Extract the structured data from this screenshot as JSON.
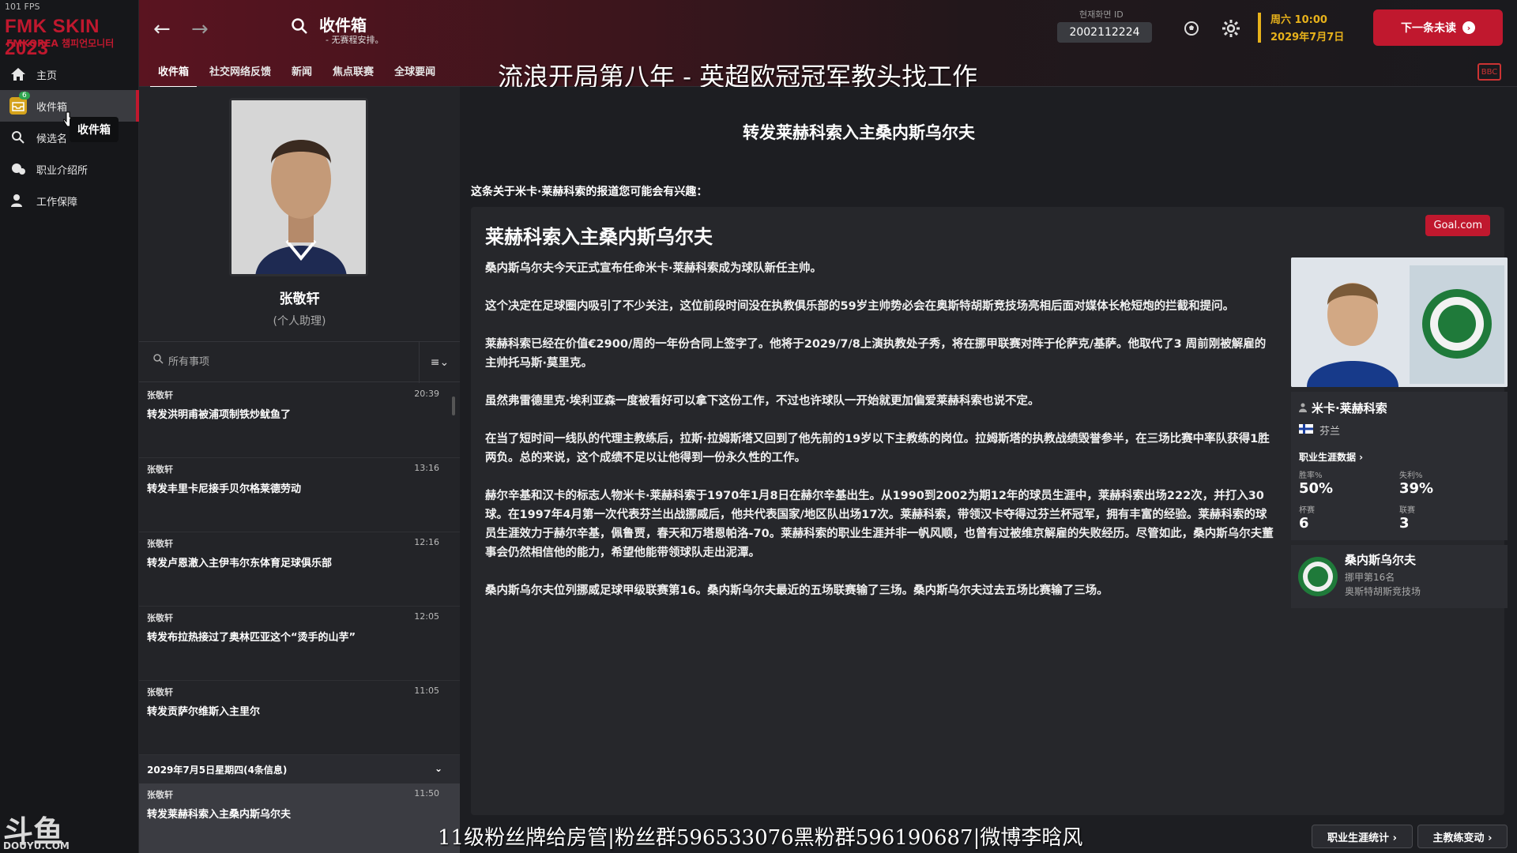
{
  "app": {
    "fps": "101 FPS",
    "logo": "FMK SKIN 2023",
    "logo_sub": "FMKOREA 챔피언모니터"
  },
  "sidebar": {
    "items": [
      {
        "label": "主页",
        "icon": "home-icon"
      },
      {
        "label": "收件箱",
        "icon": "inbox-icon",
        "badge": "6"
      },
      {
        "label": "候选名",
        "icon": "search-icon"
      },
      {
        "label": "职业介绍所",
        "icon": "agency-icon"
      },
      {
        "label": "工作保障",
        "icon": "job-security-icon"
      }
    ],
    "tooltip": "收件箱"
  },
  "header": {
    "title": "收件箱",
    "subtitle": "- 无赛程安排。",
    "tabs": [
      "收件箱",
      "社交网络反馈",
      "新闻",
      "焦点联赛",
      "全球要闻"
    ],
    "id_label": "현재화면 ID",
    "id_value": "2002112224",
    "date_line1": "周六 10:00",
    "date_line2": "2029年7月7日",
    "next_button": "下一条未读",
    "bbc": "BBC"
  },
  "overlay": {
    "top": "流浪开局第八年 - 英超欧冠冠军教头找工作",
    "bottom": "11级粉丝牌给房管|粉丝群596533076黑粉群596190687|微博李晗风",
    "douyu": "斗鱼",
    "douyu_sub": "DOUYU.COM"
  },
  "assistant": {
    "name": "张敬轩",
    "role": "(个人助理)"
  },
  "list": {
    "search_placeholder": "所有事项",
    "messages": [
      {
        "sender": "张敬轩",
        "time": "20:39",
        "subject": "转发洪明甫被浦项制铁炒鱿鱼了"
      },
      {
        "sender": "张敬轩",
        "time": "13:16",
        "subject": "转发丰里卡尼接手贝尔格莱德劳动"
      },
      {
        "sender": "张敬轩",
        "time": "12:16",
        "subject": "转发卢恩澈入主伊韦尔东体育足球俱乐部"
      },
      {
        "sender": "张敬轩",
        "time": "12:05",
        "subject": "转发布拉热接过了奥林匹亚这个“烫手的山芋”"
      },
      {
        "sender": "张敬轩",
        "time": "11:05",
        "subject": "转发贡萨尔维斯入主里尔"
      }
    ],
    "group_header": "2029年7月5日星期四(4条信息)",
    "selected": {
      "sender": "张敬轩",
      "time": "11:50",
      "subject": "转发莱赫科索入主桑内斯乌尔夫"
    }
  },
  "main": {
    "title": "转发莱赫科索入主桑内斯乌尔夫",
    "intro": "这条关于米卡·莱赫科索的报道您可能会有兴趣：",
    "article_title": "莱赫科索入主桑内斯乌尔夫",
    "source": "Goal.com",
    "paragraphs": [
      "桑内斯乌尔夫今天正式宣布任命米卡·莱赫科索成为球队新任主帅。",
      "这个决定在足球圈内吸引了不少关注，这位前段时间没在执教俱乐部的59岁主帅势必会在奥斯特胡斯竞技场亮相后面对媒体长枪短炮的拦截和提问。",
      "莱赫科索已经在价值€2900/周的一年份合同上签字了。他将于2029/7/8上演执教处子秀，将在挪甲联赛对阵于伦萨克/基萨。他取代了3 周前刚被解雇的主帅托马斯·莫里克。",
      "虽然弗雷德里克·埃利亚森一度被看好可以拿下这份工作，不过也许球队一开始就更加偏爱莱赫科索也说不定。",
      "在当了短时间一线队的代理主教练后，拉斯·拉姆斯塔又回到了他先前的19岁以下主教练的岗位。拉姆斯塔的执教战绩毁誉参半，在三场比赛中率队获得1胜两负。总的来说，这个成绩不足以让他得到一份永久性的工作。",
      "赫尔辛基和汉卡的标志人物米卡·莱赫科索于1970年1月8日在赫尔辛基出生。从1990到2002为期12年的球员生涯中，莱赫科索出场222次，并打入30球。在1997年4月第一次代表芬兰出战挪威后，他共代表国家/地区队出场17次。莱赫科索，带领汉卡夺得过芬兰杯冠军，拥有丰富的经验。莱赫科索的球员生涯效力于赫尔辛基，佩鲁贾，春天和万塔恩帕洛-70。莱赫科索的职业生涯并非一帆风顺，也曾有过被维京解雇的失败经历。尽管如此，桑内斯乌尔夫董事会仍然相信他的能力，希望他能带领球队走出泥潭。",
      "桑内斯乌尔夫位列挪威足球甲级联赛第16。桑内斯乌尔夫最近的五场联赛输了三场。桑内斯乌尔夫过去五场比赛输了三场。"
    ]
  },
  "card": {
    "name": "米卡·莱赫科索",
    "nation": "芬兰",
    "career_link": "职业生涯数据 ›",
    "stats": [
      {
        "label": "胜率%",
        "value": "50%"
      },
      {
        "label": "失利%",
        "value": "39%"
      },
      {
        "label": "杯赛",
        "value": "6"
      },
      {
        "label": "联赛",
        "value": "3"
      }
    ],
    "club_name": "桑内斯乌尔夫",
    "club_position": "挪甲第16名",
    "club_stadium": "奥斯特胡斯竞技场"
  },
  "footer": {
    "career_stats": "职业生涯统计 ›",
    "manager_moves": "主教练变动 ›"
  }
}
